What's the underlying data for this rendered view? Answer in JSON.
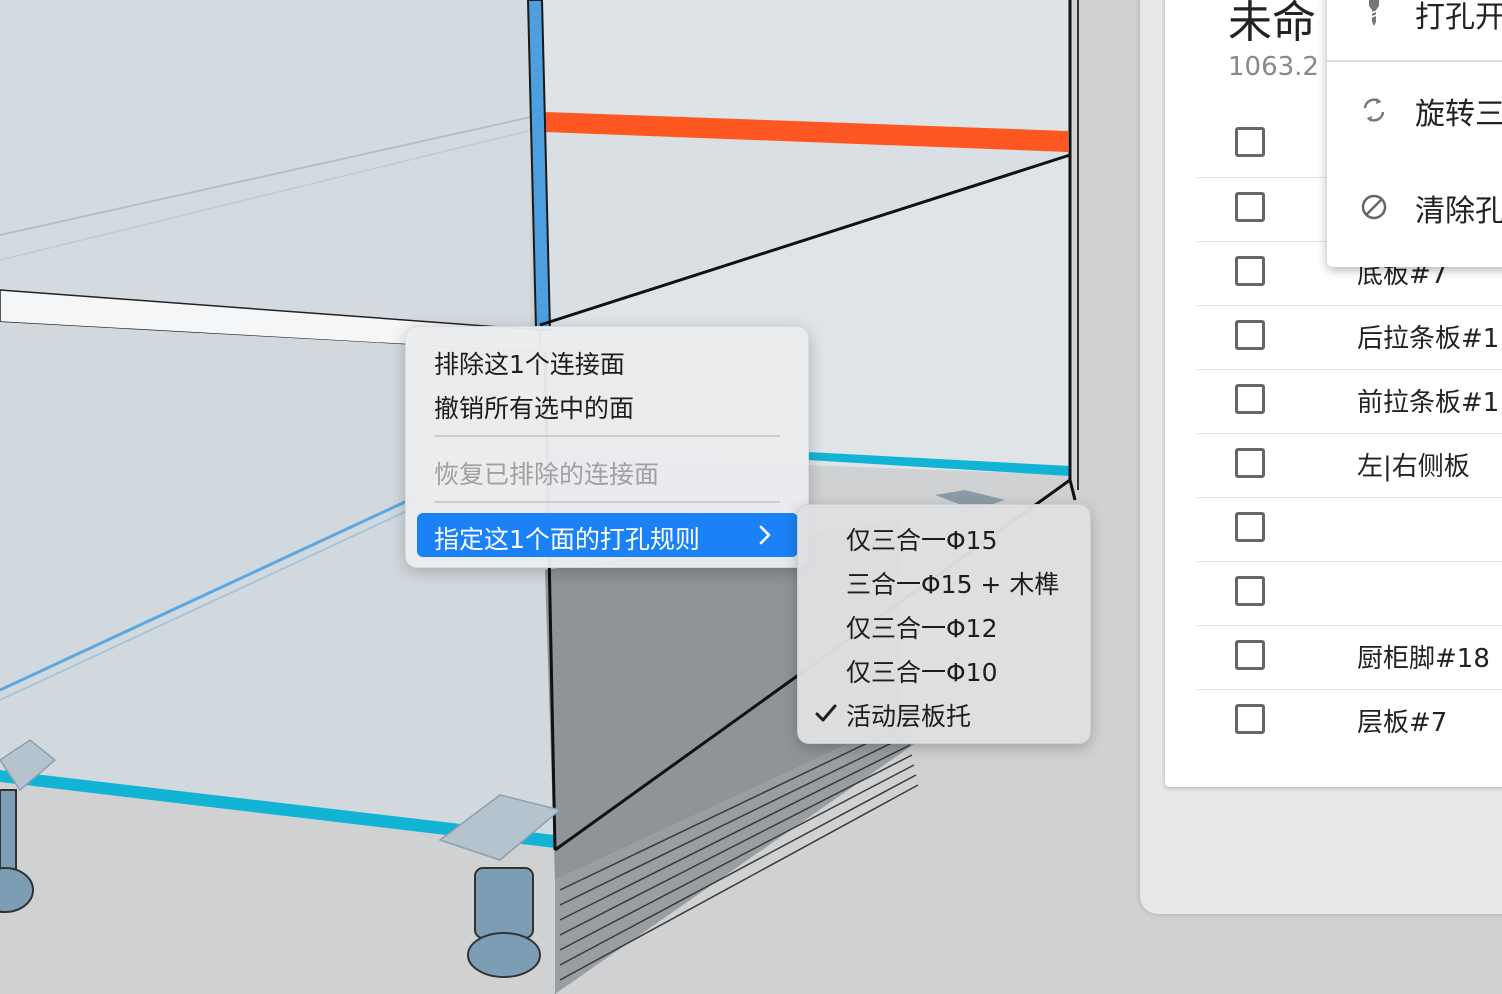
{
  "context_menu": {
    "items": [
      {
        "label": "排除这1个连接面",
        "enabled": true
      },
      {
        "label": "撤销所有选中的面",
        "enabled": true
      },
      {
        "label": "恢复已排除的连接面",
        "enabled": false
      },
      {
        "label": "指定这1个面的打孔规则",
        "enabled": true,
        "highlighted": true,
        "has_submenu": true
      }
    ]
  },
  "submenu": {
    "items": [
      {
        "label": "仅三合一Φ15",
        "checked": false
      },
      {
        "label": "三合一Φ15 + 木榫",
        "checked": false
      },
      {
        "label": "仅三合一Φ12",
        "checked": false
      },
      {
        "label": "仅三合一Φ10",
        "checked": false
      },
      {
        "label": "活动层板托",
        "checked": true
      }
    ]
  },
  "panel": {
    "title": "未命",
    "subtitle": "1063.2 :",
    "rows": [
      {
        "label": ""
      },
      {
        "label": ""
      },
      {
        "label": "底板#7"
      },
      {
        "label": "后拉条板#1"
      },
      {
        "label": "前拉条板#1"
      },
      {
        "label": "左|右侧板"
      },
      {
        "label": ""
      },
      {
        "label": ""
      },
      {
        "label": "厨柜脚#18"
      },
      {
        "label": "层板#7"
      }
    ]
  },
  "tool_menu": {
    "items": [
      {
        "icon": "drill-icon",
        "label": "打孔开"
      },
      {
        "icon": "rotate-icon",
        "label": "旋转三"
      },
      {
        "icon": "clear-icon",
        "label": "清除孔"
      }
    ]
  },
  "colors": {
    "highlight": "#1a82f6",
    "selected_edge_orange": "#ff5722",
    "panel_edge_blue": "#4d9fe0",
    "cyan_edge": "#12b4d6"
  }
}
